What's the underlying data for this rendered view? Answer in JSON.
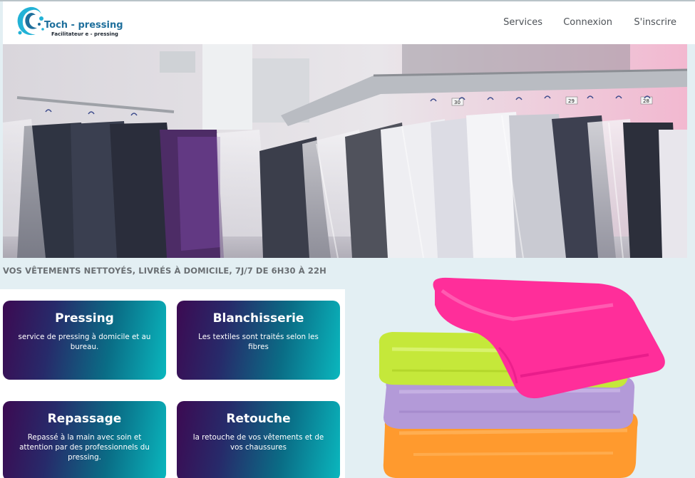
{
  "brand": {
    "name": "Toch - pressing",
    "tagline": "Facilitateur e - pressing",
    "colors": {
      "primary": "#1e6f9c",
      "accent": "#22b2d6"
    }
  },
  "nav": {
    "items": [
      {
        "label": "Services"
      },
      {
        "label": "Connexion"
      },
      {
        "label": "S'inscrire"
      }
    ]
  },
  "hero": {
    "description": "clothes-rack-photo",
    "tag_numbers": [
      "30",
      "29",
      "28"
    ]
  },
  "headline": "VOS VÊTEMENTS NETTOYÉS, LIVRÉS À DOMICILE, 7J/7 DE 6H30 À 22H",
  "services": [
    {
      "title": "Pressing",
      "description": "service de pressing à domicile et au bureau."
    },
    {
      "title": "Blanchisserie",
      "description": "Les textiles sont traités selon les fibres"
    },
    {
      "title": "Repassage",
      "description": "Repassé à la main avec soin et attention par des professionnels du pressing."
    },
    {
      "title": "Retouche",
      "description": "la retouche de vos vêtements et de vos chaussures"
    }
  ],
  "card_gradient": [
    "#3c0a52",
    "#272a6a",
    "#0a6d86",
    "#0ab7be"
  ],
  "towel_colors": [
    "#ff2e9a",
    "#c5e83a",
    "#b39ad8",
    "#ff9a2e"
  ]
}
